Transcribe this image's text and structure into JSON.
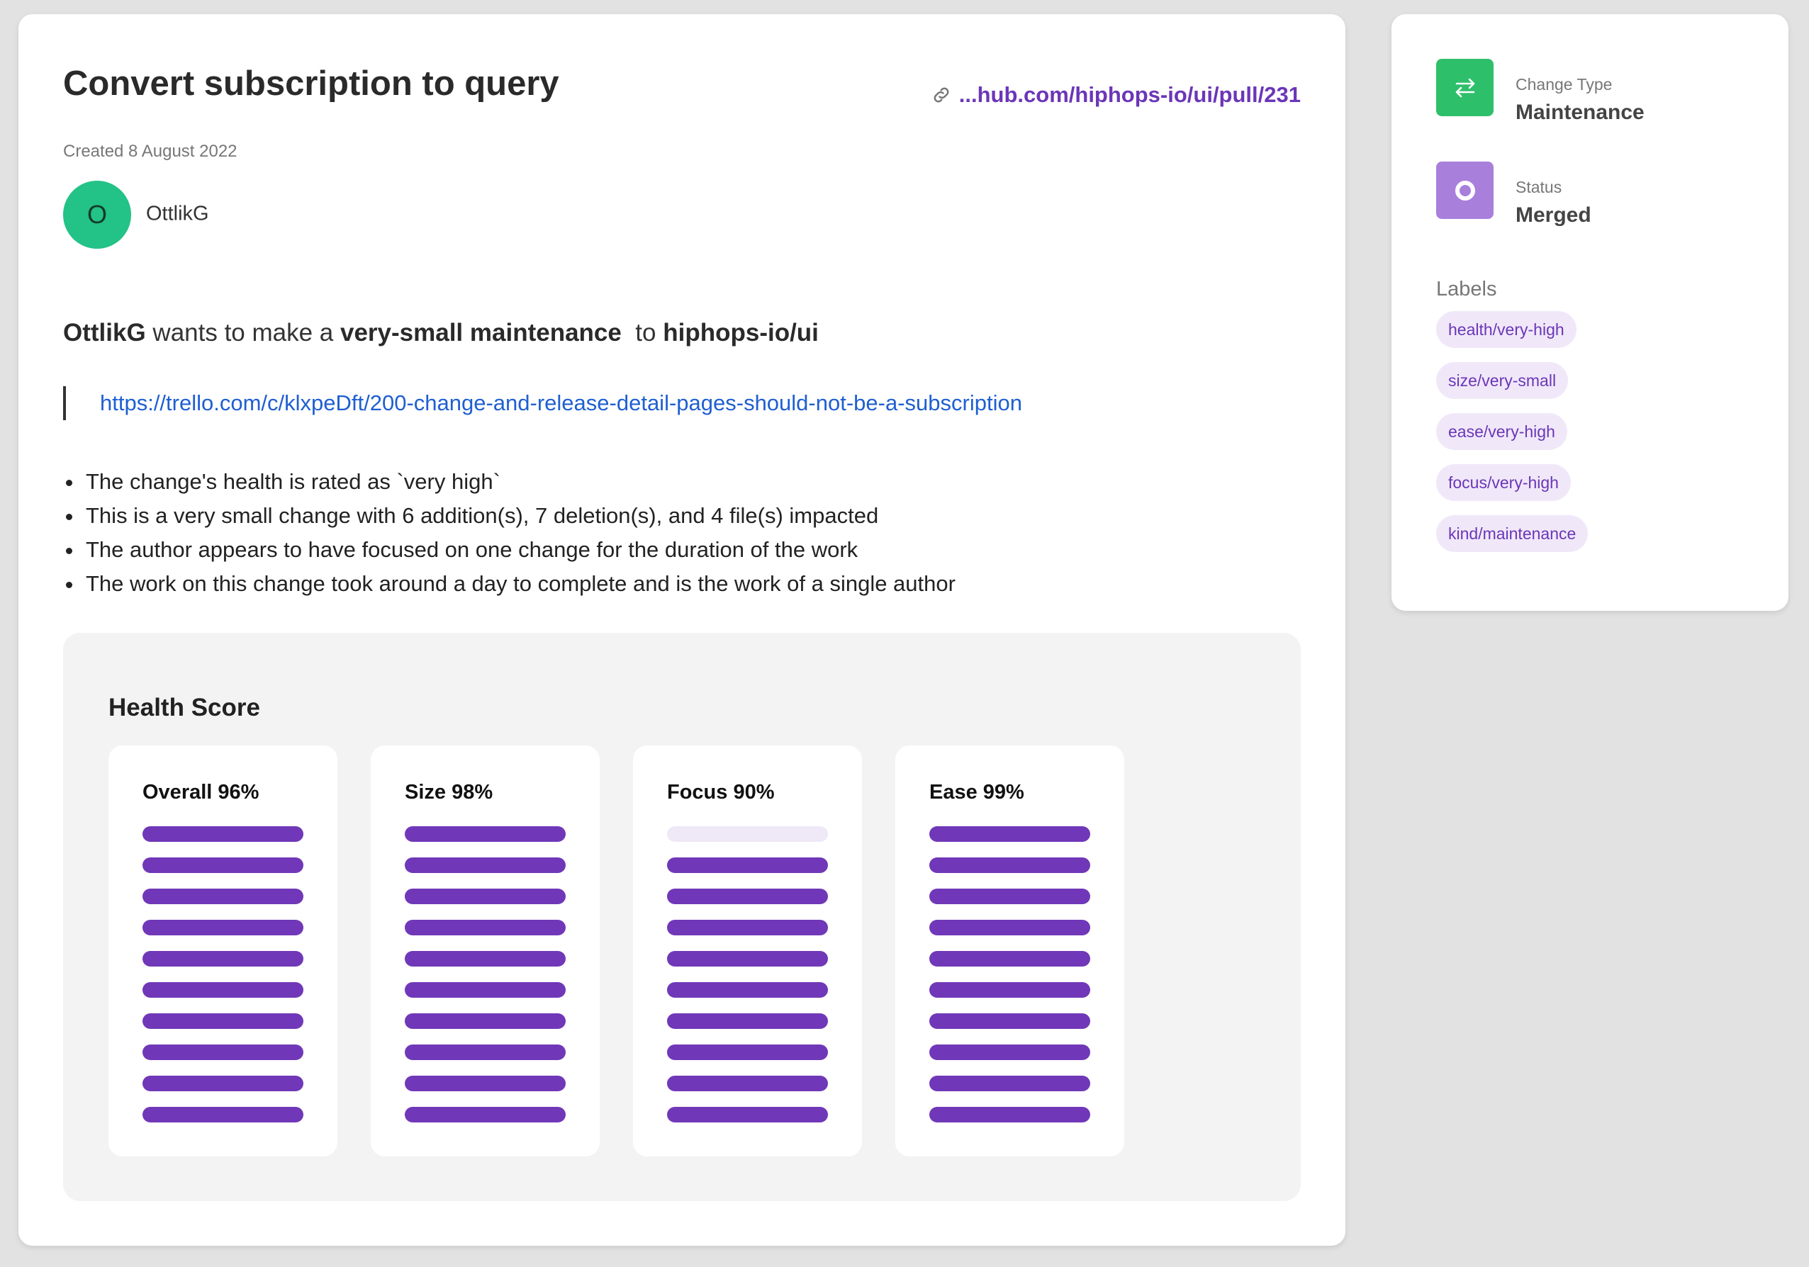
{
  "pr": {
    "title": "Convert subscription to query",
    "link_text": "...hub.com/hiphops-io/ui/pull/231",
    "created": "Created 8 August 2022"
  },
  "author": {
    "initial": "O",
    "name": "OttlikG"
  },
  "summary": {
    "author": "OttlikG",
    "text1": " wants to make a ",
    "size_kind": "very-small maintenance",
    "text2": "  to ",
    "repo": "hiphops-io/ui"
  },
  "quote_link": "https://trello.com/c/klxpeDft/200-change-and-release-detail-pages-should-not-be-a-subscription",
  "bullets": [
    "The change's health is rated as `very high`",
    "This is a very small change with 6 addition(s), 7 deletion(s), and 4 file(s) impacted",
    "The author appears to have focused on one change for the duration of the work",
    "The work on this change took around a day to complete and is the work of a single author"
  ],
  "health": {
    "title": "Health Score",
    "scores": [
      {
        "label": "Overall 96%",
        "filled_bars": 10,
        "total_bars": 10
      },
      {
        "label": "Size 98%",
        "filled_bars": 10,
        "total_bars": 10
      },
      {
        "label": "Focus 90%",
        "filled_bars": 9,
        "total_bars": 10
      },
      {
        "label": "Ease 99%",
        "filled_bars": 10,
        "total_bars": 10
      }
    ]
  },
  "sidebar": {
    "change_type_label": "Change Type",
    "change_type_value": "Maintenance",
    "status_label": "Status",
    "status_value": "Merged",
    "labels_heading": "Labels",
    "labels": [
      "health/very-high",
      "size/very-small",
      "ease/very-high",
      "focus/very-high",
      "kind/maintenance"
    ]
  },
  "colors": {
    "accent_purple": "#7038b8",
    "link_blue": "#1f5fd1",
    "avatar_green": "#23c286",
    "change_type_green": "#2ebf6a",
    "status_purple": "#a97fdc",
    "chip_background": "#f0e8f9"
  },
  "icons": {
    "link": "link-icon",
    "change_type": "swap-arrows-icon",
    "status": "merged-circle-icon"
  }
}
